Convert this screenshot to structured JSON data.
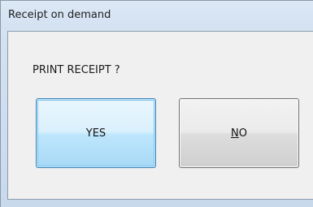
{
  "window": {
    "title": "Receipt on demand"
  },
  "dialog": {
    "prompt": "PRINT RECEIPT ?",
    "yes_label": "YES",
    "no_label_mnemonic": "N",
    "no_label_rest": "O"
  },
  "colors": {
    "title_bar": "#d4e2f2",
    "client_background": "#f0f0f0",
    "yes_button_fill": "#bee6fd",
    "yes_button_border": "#3c7fb1",
    "no_button_fill": "#e5e5e5",
    "no_button_border": "#707070"
  }
}
